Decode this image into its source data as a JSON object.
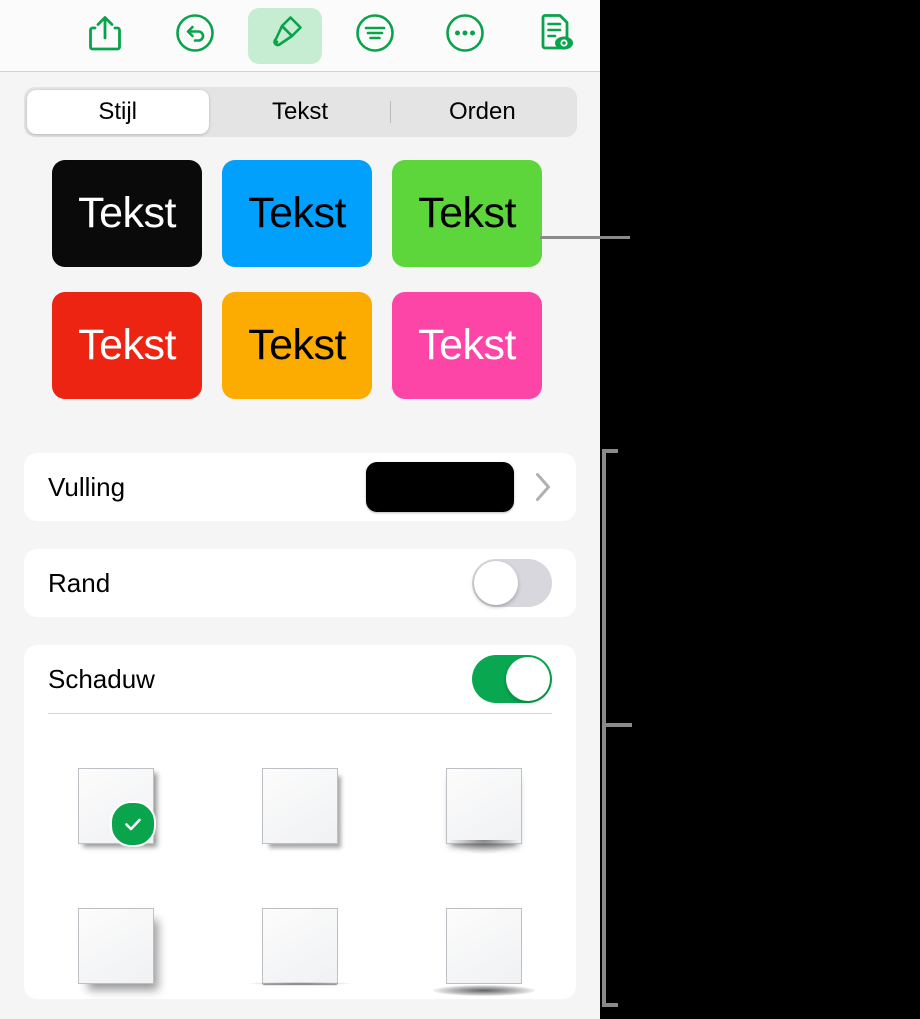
{
  "toolbar": {
    "buttons": [
      {
        "name": "share-icon",
        "label": "Deel",
        "active": false
      },
      {
        "name": "undo-icon",
        "label": "Herstel",
        "active": false
      },
      {
        "name": "paintbrush-icon",
        "label": "Opmaak",
        "active": true
      },
      {
        "name": "format-text-icon",
        "label": "Tekstopmaak",
        "active": false
      },
      {
        "name": "more-icon",
        "label": "Meer",
        "active": false
      },
      {
        "name": "document-view-icon",
        "label": "Documentweergave",
        "active": false
      }
    ],
    "accent_color": "#09A34B",
    "active_background": "#C6ECD2"
  },
  "segmented_control": {
    "tabs": [
      {
        "label": "Stijl",
        "selected": true
      },
      {
        "label": "Tekst",
        "selected": false
      },
      {
        "label": "Orden",
        "selected": false
      }
    ]
  },
  "style_swatches": [
    {
      "label": "Tekst",
      "background": "#0A0A0A",
      "text_color": "#FFFFFF"
    },
    {
      "label": "Tekst",
      "background": "#01A0FC",
      "text_color": "#000000"
    },
    {
      "label": "Tekst",
      "background": "#5CD63A",
      "text_color": "#000000"
    },
    {
      "label": "Tekst",
      "background": "#EE2412",
      "text_color": "#FFFFFF"
    },
    {
      "label": "Tekst",
      "background": "#FCAB01",
      "text_color": "#000000"
    },
    {
      "label": "Tekst",
      "background": "#FD45A8",
      "text_color": "#FFFFFF"
    }
  ],
  "options": {
    "fill": {
      "label": "Vulling",
      "color_value": "#000000",
      "disclosure_icon": "chevron-right-icon"
    },
    "border": {
      "label": "Rand",
      "enabled": false,
      "off_track_color": "#D8D7DD"
    },
    "shadow": {
      "label": "Schaduw",
      "enabled": true,
      "on_track_color": "#09A850",
      "styles": [
        {
          "name": "shadow-style-contact",
          "selected": true
        },
        {
          "name": "shadow-style-drop",
          "selected": false
        },
        {
          "name": "shadow-style-curved",
          "selected": false
        },
        {
          "name": "shadow-style-soft",
          "selected": false
        },
        {
          "name": "shadow-style-line",
          "selected": false
        },
        {
          "name": "shadow-style-ellipse",
          "selected": false
        }
      ],
      "selected_indicator": "checkmark-icon"
    }
  },
  "annotations": {
    "callout_line_color": "#8A8A8A",
    "bracket_color": "#8A8A8A"
  }
}
